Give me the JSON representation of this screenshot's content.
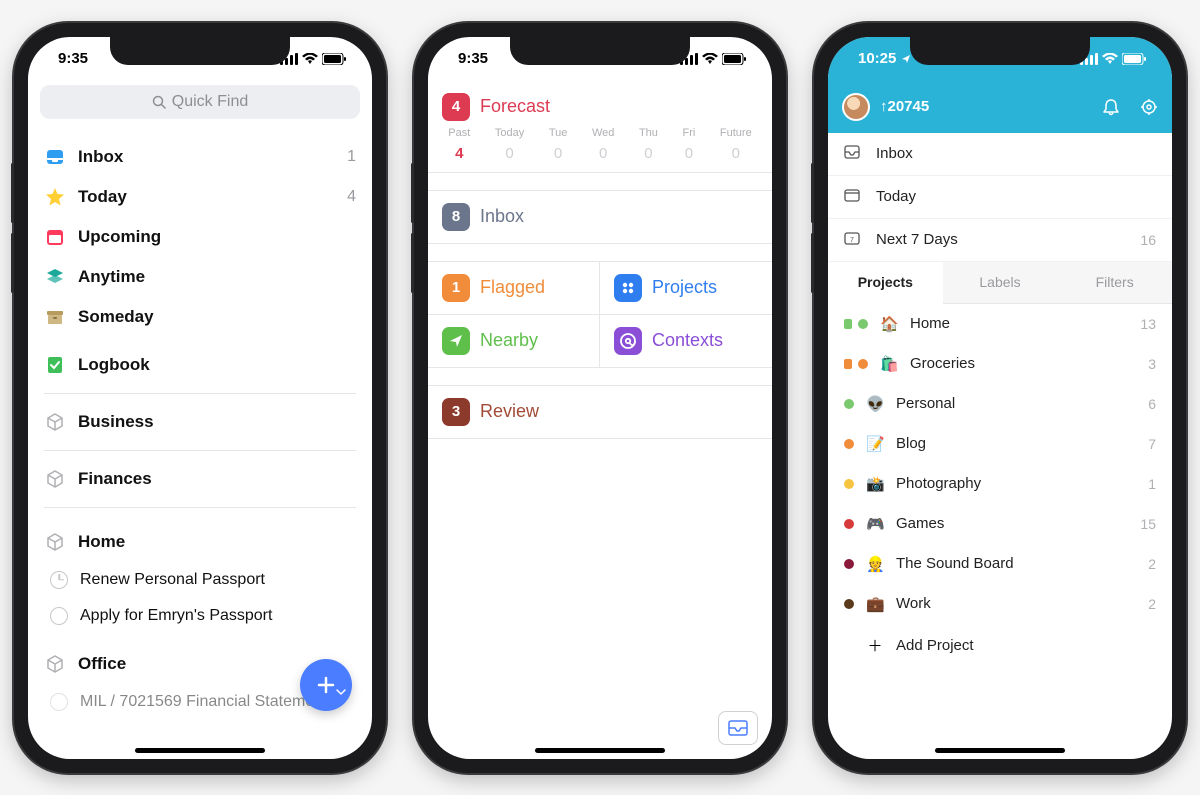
{
  "phone1": {
    "time": "9:35",
    "quickfind_placeholder": "Quick Find",
    "inbox": {
      "label": "Inbox",
      "count": "1"
    },
    "today": {
      "label": "Today",
      "count": "4"
    },
    "upcoming": {
      "label": "Upcoming"
    },
    "anytime": {
      "label": "Anytime"
    },
    "someday": {
      "label": "Someday"
    },
    "logbook": {
      "label": "Logbook"
    },
    "areas": {
      "business": "Business",
      "finances": "Finances",
      "home": "Home",
      "office": "Office"
    },
    "tasks": {
      "renew": "Renew Personal Passport",
      "emryn": "Apply for Emryn's Passport",
      "mil": "MIL / 7021569 Financial Statements"
    }
  },
  "phone2": {
    "time": "9:35",
    "forecast": {
      "badge": "4",
      "label": "Forecast",
      "color": "#dc3b52"
    },
    "days": [
      {
        "lbl": "Past",
        "val": "4",
        "active": true
      },
      {
        "lbl": "Today",
        "val": "0"
      },
      {
        "lbl": "Tue",
        "val": "0"
      },
      {
        "lbl": "Wed",
        "val": "0"
      },
      {
        "lbl": "Thu",
        "val": "0"
      },
      {
        "lbl": "Fri",
        "val": "0"
      },
      {
        "lbl": "Future",
        "val": "0"
      }
    ],
    "inbox": {
      "badge": "8",
      "label": "Inbox",
      "badgeColor": "#6b768c",
      "textColor": "#6b768c"
    },
    "flagged": {
      "badge": "1",
      "label": "Flagged",
      "badgeColor": "#f08c3a",
      "textColor": "#f08c3a"
    },
    "projects": {
      "label": "Projects",
      "iconColor": "#2f7ef0",
      "textColor": "#2f7ef0"
    },
    "nearby": {
      "label": "Nearby",
      "iconColor": "#5fbf4b",
      "textColor": "#5fbf4b"
    },
    "contexts": {
      "label": "Contexts",
      "iconColor": "#8a4fd6",
      "textColor": "#8a4fd6"
    },
    "review": {
      "badge": "3",
      "label": "Review",
      "badgeColor": "#8b3a2c",
      "textColor": "#a24a36"
    }
  },
  "phone3": {
    "time": "10:25",
    "karma": "20745",
    "inbox": {
      "label": "Inbox"
    },
    "today": {
      "label": "Today"
    },
    "next7": {
      "label": "Next 7 Days",
      "count": "16"
    },
    "tabs": {
      "projects": "Projects",
      "labels": "Labels",
      "filters": "Filters"
    },
    "projects": [
      {
        "dot": "#7bc96f",
        "shared": "green",
        "emoji": "🏠",
        "label": "Home",
        "count": "13"
      },
      {
        "dot": "#f08c3a",
        "shared": "orange",
        "emoji": "🛍️",
        "label": "Groceries",
        "count": "3"
      },
      {
        "dot": "#7bc96f",
        "emoji": "👽",
        "label": "Personal",
        "count": "6"
      },
      {
        "dot": "#f08c3a",
        "emoji": "📝",
        "label": "Blog",
        "count": "7"
      },
      {
        "dot": "#f5c542",
        "emoji": "📸",
        "label": "Photography",
        "count": "1"
      },
      {
        "dot": "#d63a3a",
        "emoji": "🎮",
        "label": "Games",
        "count": "15"
      },
      {
        "dot": "#8b1a3a",
        "emoji": "👷",
        "label": "The Sound Board",
        "count": "2"
      },
      {
        "dot": "#5a3a1a",
        "emoji": "💼",
        "label": "Work",
        "count": "2"
      }
    ],
    "add_project": "Add Project"
  }
}
